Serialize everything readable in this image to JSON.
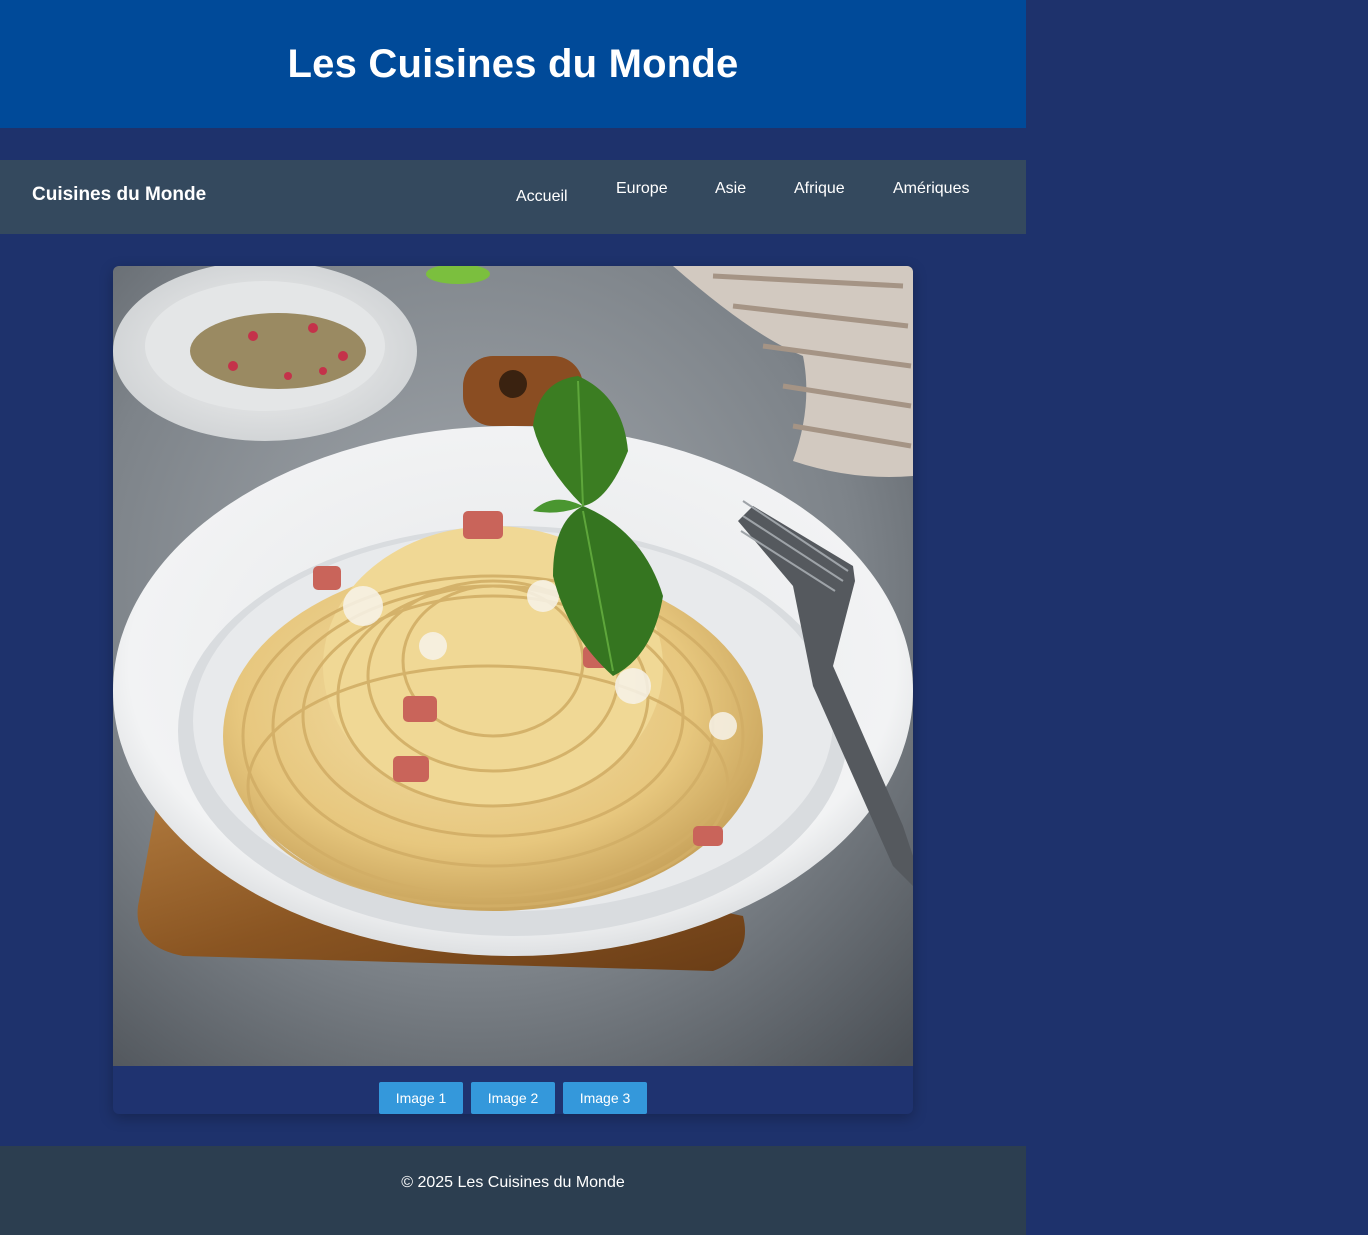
{
  "header": {
    "title": "Les Cuisines du Monde"
  },
  "navbar": {
    "brand": "Cuisines du Monde",
    "links": [
      {
        "label": "Accueil"
      },
      {
        "label": "Europe"
      },
      {
        "label": "Asie"
      },
      {
        "label": "Afrique"
      },
      {
        "label": "Amériques"
      }
    ]
  },
  "slider": {
    "photo_subject": "pasta-carbonara-photo",
    "buttons": [
      {
        "label": "Image 1"
      },
      {
        "label": "Image 2"
      },
      {
        "label": "Image 3"
      }
    ]
  },
  "footer": {
    "text": "© 2025 Les Cuisines du Monde"
  },
  "colors": {
    "page_bg": "#1e326c",
    "header_bg": "#004a99",
    "navbar_bg": "#34495e",
    "footer_bg": "#2c3e50",
    "button_bg": "#3498db",
    "text": "#ffffff"
  }
}
